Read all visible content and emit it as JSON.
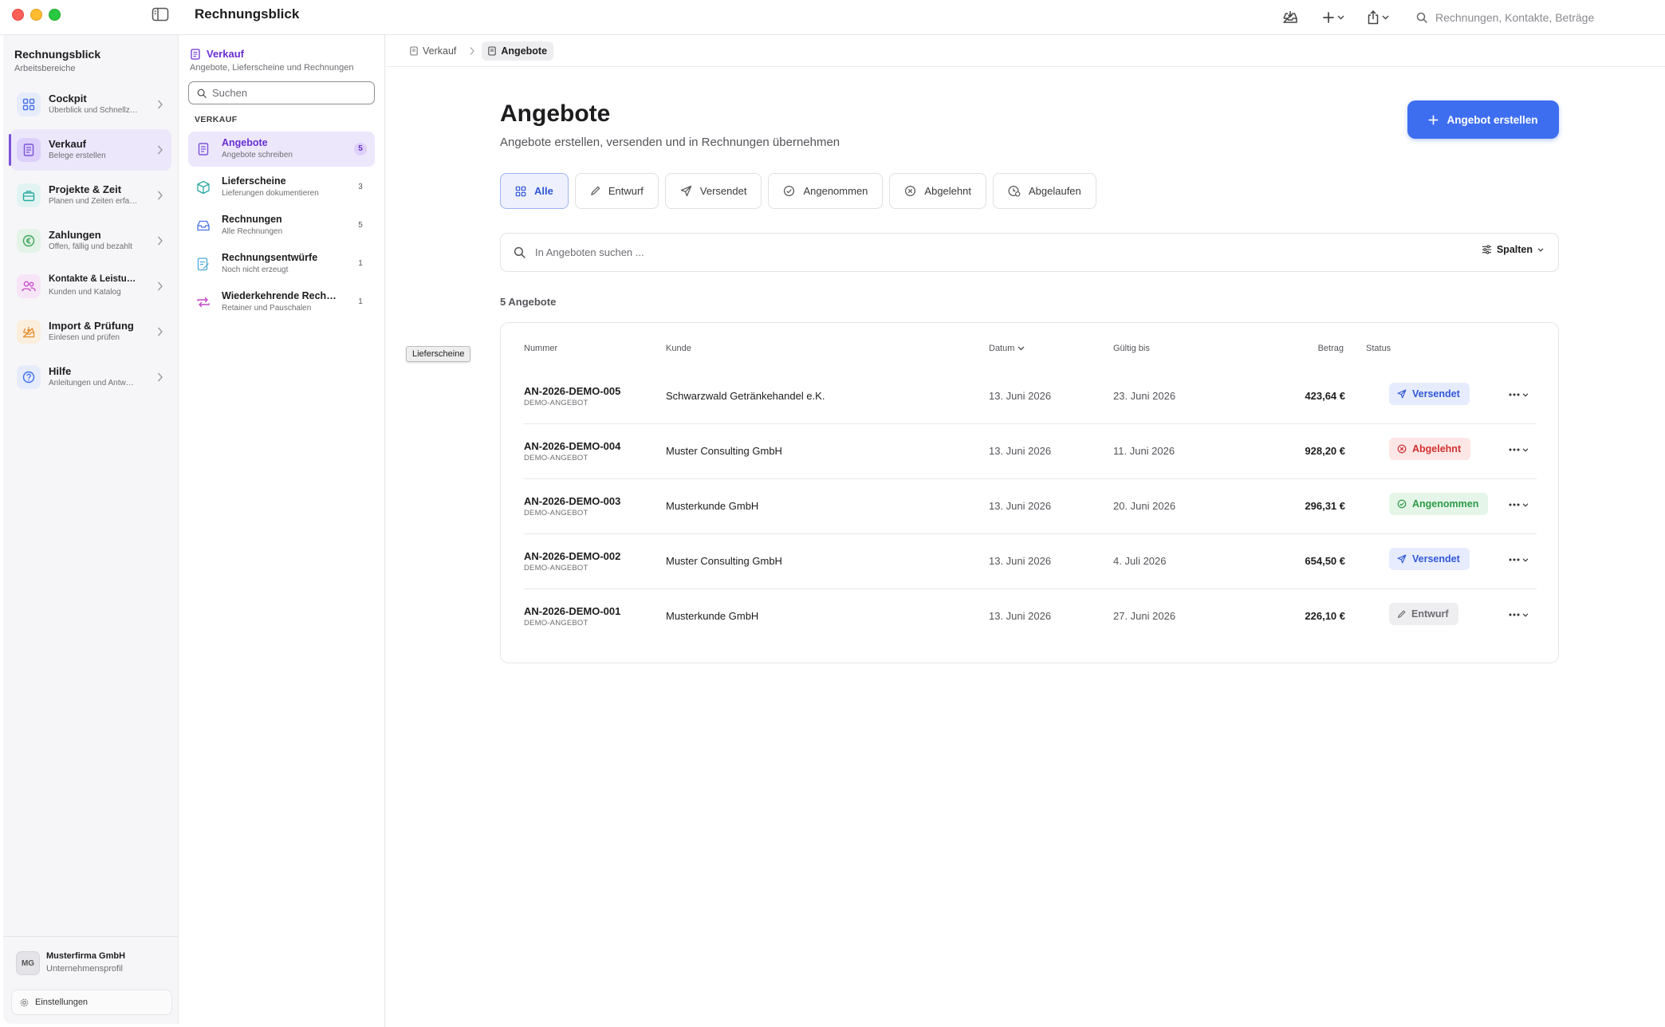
{
  "window": {
    "app_title": "Rechnungsblick",
    "global_search_placeholder": "Rechnungen, Kontakte, Beträge"
  },
  "sidebar": {
    "title": "Rechnungsblick",
    "subtitle": "Arbeitsbereiche",
    "items": [
      {
        "label": "Cockpit",
        "sub": "Überblick und Schnellzugriff",
        "icon": "grid-icon",
        "color": "#4a72e8"
      },
      {
        "label": "Verkauf",
        "sub": "Belege erstellen",
        "icon": "document-icon",
        "color": "#7b52d9",
        "active": true
      },
      {
        "label": "Projekte & Zeit",
        "sub": "Planen und Zeiten erfassen",
        "icon": "briefcase-icon",
        "color": "#2aa9a0"
      },
      {
        "label": "Zahlungen",
        "sub": "Offen, fällig und bezahlt",
        "icon": "euro-icon",
        "color": "#3aa55a"
      },
      {
        "label": "Kontakte & Leistungen",
        "sub": "Kunden und Katalog",
        "icon": "people-icon",
        "color": "#c447c7"
      },
      {
        "label": "Import & Prüfung",
        "sub": "Einlesen und prüfen",
        "icon": "inbox-icon",
        "color": "#e28b2b"
      },
      {
        "label": "Hilfe",
        "sub": "Anleitungen und Antworten",
        "icon": "help-icon",
        "color": "#3e6ef0"
      }
    ],
    "account": {
      "initials": "MG",
      "name": "Musterfirma GmbH",
      "sub": "Unternehmensprofil"
    },
    "settings_label": "Einstellungen"
  },
  "subnav": {
    "title": "Verkauf",
    "subtitle": "Angebote, Lieferscheine und Rechnungen",
    "search_placeholder": "Suchen",
    "section": "VERKAUF",
    "items": [
      {
        "label": "Angebote",
        "sub": "Angebote schreiben",
        "count": "5",
        "active": true
      },
      {
        "label": "Lieferscheine",
        "sub": "Lieferungen dokumentieren",
        "count": "3"
      },
      {
        "label": "Rechnungen",
        "sub": "Alle Rechnungen",
        "count": "5"
      },
      {
        "label": "Rechnungsentwürfe",
        "sub": "Noch nicht erzeugt",
        "count": "1"
      },
      {
        "label": "Wiederkehrende Rechnungen",
        "sub": "Retainer und Pauschalen",
        "count": "1"
      }
    ]
  },
  "breadcrumb": {
    "parent": "Verkauf",
    "current": "Angebote"
  },
  "tooltip": "Lieferscheine",
  "main": {
    "title": "Angebote",
    "subtitle": "Angebote erstellen, versenden und in Rechnungen übernehmen",
    "create_button": "Angebot erstellen",
    "filters": [
      "Alle",
      "Entwurf",
      "Versendet",
      "Angenommen",
      "Abgelehnt",
      "Abgelaufen"
    ],
    "search_placeholder": "In Angeboten suchen ...",
    "columns_button": "Spalten",
    "count_label": "5 Angebote"
  },
  "table": {
    "headers": {
      "number": "Nummer",
      "customer": "Kunde",
      "date": "Datum",
      "valid": "Gültig bis",
      "amount": "Betrag",
      "status": "Status"
    },
    "rows": [
      {
        "number": "AN-2026-DEMO-005",
        "tag": "DEMO-ANGEBOT",
        "customer": "Schwarzwald Getränkehandel e.K.",
        "date": "13. Juni 2026",
        "valid": "23. Juni 2026",
        "amount": "423,64 €",
        "status": "Versendet"
      },
      {
        "number": "AN-2026-DEMO-004",
        "tag": "DEMO-ANGEBOT",
        "customer": "Muster Consulting GmbH",
        "date": "13. Juni 2026",
        "valid": "11. Juni 2026",
        "amount": "928,20 €",
        "status": "Abgelehnt"
      },
      {
        "number": "AN-2026-DEMO-003",
        "tag": "DEMO-ANGEBOT",
        "customer": "Musterkunde GmbH",
        "date": "13. Juni 2026",
        "valid": "20. Juni 2026",
        "amount": "296,31 €",
        "status": "Angenommen"
      },
      {
        "number": "AN-2026-DEMO-002",
        "tag": "DEMO-ANGEBOT",
        "customer": "Muster Consulting GmbH",
        "date": "13. Juni 2026",
        "valid": "4. Juli 2026",
        "amount": "654,50 €",
        "status": "Versendet"
      },
      {
        "number": "AN-2026-DEMO-001",
        "tag": "DEMO-ANGEBOT",
        "customer": "Musterkunde GmbH",
        "date": "13. Juni 2026",
        "valid": "27. Juni 2026",
        "amount": "226,10 €",
        "status": "Entwurf"
      }
    ]
  },
  "colors": {
    "accent": "#3e6ef0",
    "brand_purple": "#6a2fd1",
    "sent": "#3358d6",
    "rejected": "#d03131",
    "accepted": "#2d9a47",
    "draft": "#6e6e73"
  }
}
